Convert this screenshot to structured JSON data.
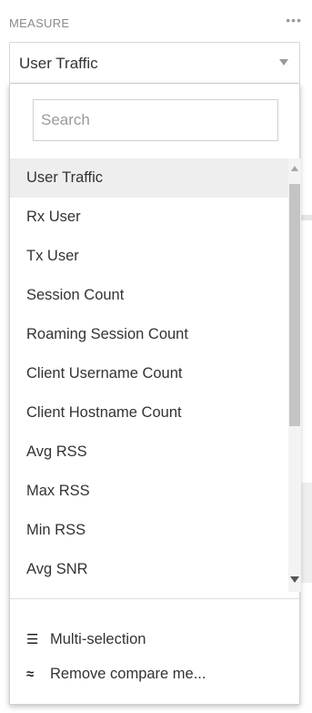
{
  "header": {
    "title": "MEASURE",
    "more_icon": "more-horizontal-icon"
  },
  "select": {
    "value": "User Traffic"
  },
  "search": {
    "placeholder": "Search",
    "value": ""
  },
  "list": {
    "selected": "User Traffic",
    "items": [
      "User Traffic",
      "Rx User",
      "Tx User",
      "Session Count",
      "Roaming Session Count",
      "Client Username Count",
      "Client Hostname Count",
      "Avg RSS",
      "Max RSS",
      "Min RSS",
      "Avg SNR"
    ]
  },
  "actions": {
    "multi_selection_label": "Multi-selection",
    "multi_selection_icon": "list-icon",
    "remove_compare_label": "Remove compare me...",
    "remove_compare_icon": "compare-waves-icon"
  },
  "colors": {
    "selected_bg": "#eeeeee",
    "text": "#333333",
    "muted": "#8a8a8a"
  }
}
